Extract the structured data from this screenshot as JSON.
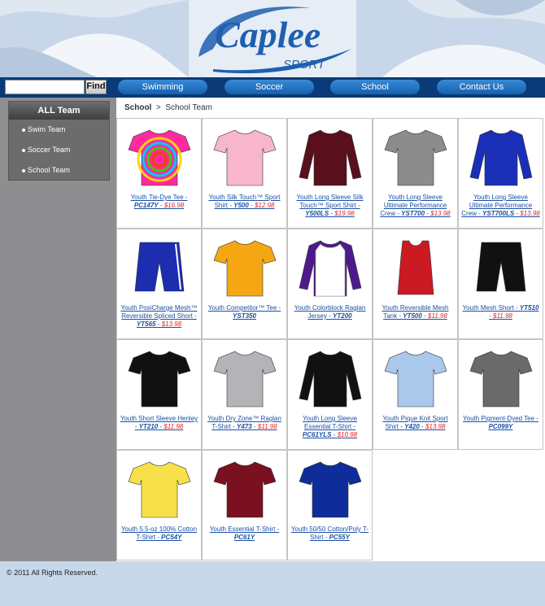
{
  "brand": {
    "logo_text": "Caplee",
    "logo_subtext": "SPORT",
    "accent_color": "#1f5fb0"
  },
  "search": {
    "placeholder": "",
    "value": "",
    "button_label": "Find"
  },
  "nav": {
    "items": [
      {
        "label": "Swimming"
      },
      {
        "label": "Soccer"
      },
      {
        "label": "School"
      },
      {
        "label": "Contact Us"
      }
    ]
  },
  "sidebar": {
    "title": "ALL Team",
    "items": [
      {
        "label": "Swim Team"
      },
      {
        "label": "Soccer Team"
      },
      {
        "label": "School Team"
      }
    ]
  },
  "breadcrumb": {
    "root": "School",
    "separator": ">",
    "current": "School Team"
  },
  "products": [
    {
      "name": "Youth Tie-Dye Tee - ",
      "code": "PC147Y",
      "price": "$16.98",
      "icon": "tie-dye-tee-icon",
      "color": "#ff2aa0"
    },
    {
      "name": "Youth Silk Touch™ Sport Shirt - ",
      "code": "Y500",
      "price": "$12.98",
      "icon": "polo-shirt-icon",
      "color": "#f7b6cc"
    },
    {
      "name": "Youth Long Sleeve Silk Touch™ Sport Shirt - ",
      "code": "Y500LS",
      "price": "$19.98",
      "icon": "long-sleeve-polo-icon",
      "color": "#5a0f1c"
    },
    {
      "name": "Youth Long Sleeve Ultimate Performance Crew - ",
      "code": "YST700",
      "price": "$13.98",
      "icon": "performance-tee-icon",
      "color": "#8c8c8c"
    },
    {
      "name": "Youth Long Sleeve Ultimate Performance Crew - ",
      "code": "YST700LS",
      "price": "$13.98",
      "icon": "long-sleeve-tee-icon",
      "color": "#1a2fb8"
    },
    {
      "name": "Youth PosiCharge Mesh™ Reversible Spliced Short - ",
      "code": "YT565",
      "price": "$13.98",
      "icon": "mesh-short-icon",
      "color": "#1c2db0"
    },
    {
      "name": "Youth Competitor™ Tee - ",
      "code": "YST350",
      "price": "",
      "icon": "competitor-tee-icon",
      "color": "#f5a713"
    },
    {
      "name": "Youth Colorblock Raglan Jersey - ",
      "code": "YT200",
      "price": "",
      "icon": "raglan-jersey-icon",
      "color": "#4d1a8c"
    },
    {
      "name": "Youth Reversible Mesh Tank - ",
      "code": "YT500",
      "price": "$11.98",
      "icon": "mesh-tank-icon",
      "color": "#cc1a22"
    },
    {
      "name": "Youth Mesh Short - ",
      "code": "YT510",
      "price": "$11.98",
      "icon": "black-short-icon",
      "color": "#111111"
    },
    {
      "name": "Youth Short Sleeve Henley - ",
      "code": "YT210",
      "price": "$11.98",
      "icon": "henley-shirt-icon",
      "color": "#111111"
    },
    {
      "name": "Youth Dry Zone™ Raglan T-Shirt - ",
      "code": "Y473",
      "price": "$11.98",
      "icon": "raglan-tshirt-icon",
      "color": "#b3b3b8"
    },
    {
      "name": "Youth Long Sleeve Essential T-Shirt - ",
      "code": "PC61YLS",
      "price": "$10.98",
      "icon": "long-sleeve-tshirt-icon",
      "color": "#111111"
    },
    {
      "name": "Youth Pique Knit Sport Shirt - ",
      "code": "Y420",
      "price": "$13.98",
      "icon": "pique-polo-icon",
      "color": "#a9c8ea"
    },
    {
      "name": "Youth Pigment-Dyed Tee - ",
      "code": "PC099Y",
      "price": "",
      "icon": "pigment-tee-icon",
      "color": "#6a6a6a"
    },
    {
      "name": "Youth 5.5-oz 100% Cotton T-Shirt - ",
      "code": "PC54Y",
      "price": "",
      "icon": "cotton-tshirt-icon",
      "color": "#f7e04a"
    },
    {
      "name": "Youth Essential T-Shirt - ",
      "code": "PC61Y",
      "price": "",
      "icon": "essential-tshirt-icon",
      "color": "#7a1020"
    },
    {
      "name": "Youth 50/50 Cotton/Poly T-Shirt - ",
      "code": "PC55Y",
      "price": "",
      "icon": "blend-tshirt-icon",
      "color": "#0f2d9a"
    }
  ],
  "footer": {
    "copyright": "© 2011  All Rights Reserved."
  }
}
